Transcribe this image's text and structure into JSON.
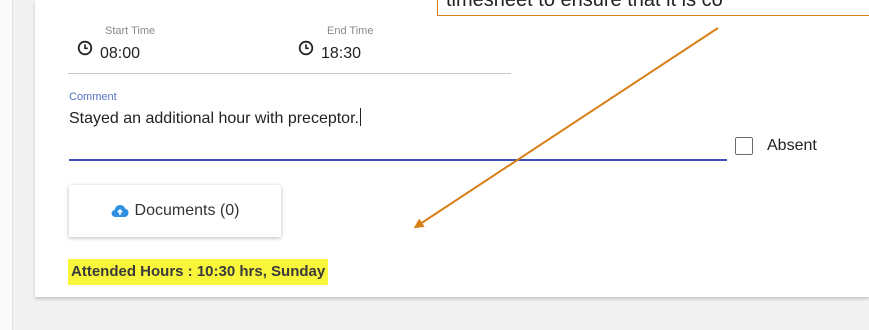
{
  "callout": {
    "text": "timesheet to ensure that it is co"
  },
  "time": {
    "start_label": "Start Time",
    "start_value": "08:00",
    "end_label": "End Time",
    "end_value": "18:30"
  },
  "comment": {
    "label": "Comment",
    "value": "Stayed an additional hour with preceptor."
  },
  "absent": {
    "label": "Absent",
    "checked": false
  },
  "documents": {
    "label": "Documents (0)",
    "icon": "cloud-upload-icon"
  },
  "attended": {
    "text": "Attended Hours : 10:30 hrs, Sunday"
  },
  "colors": {
    "accent": "#3d4fb8",
    "label_accent": "#5470c6",
    "highlight": "#f8f53a",
    "callout_border": "#d77f16",
    "cloud_icon": "#2f8fe0"
  }
}
